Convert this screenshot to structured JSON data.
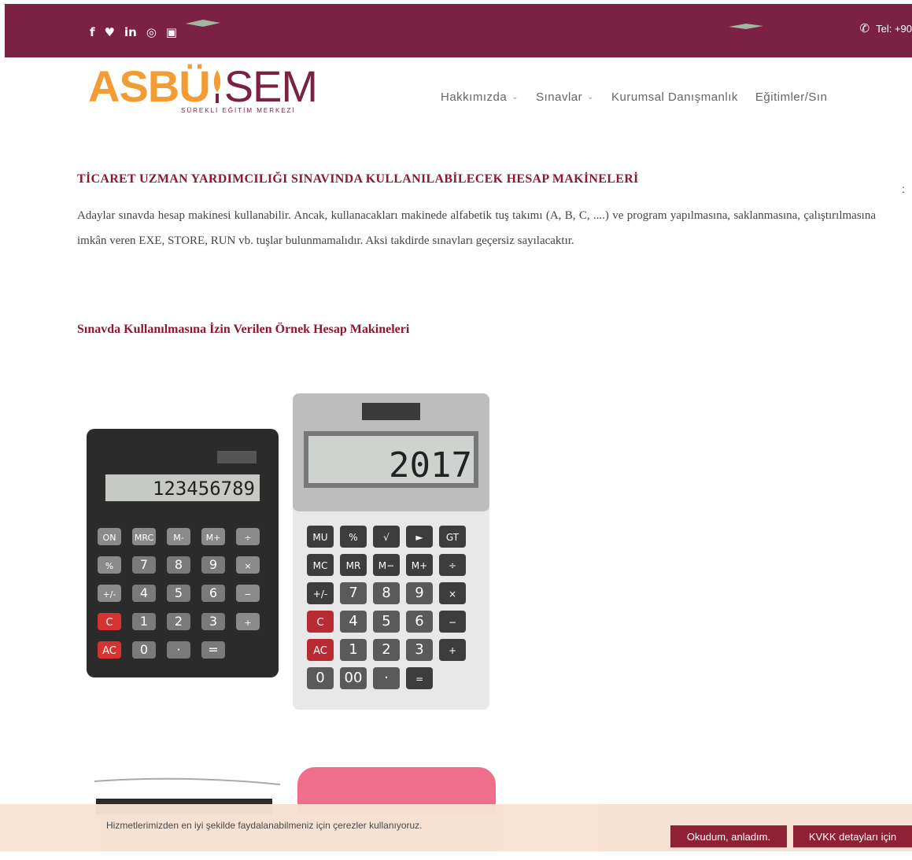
{
  "topbar": {
    "social": [
      {
        "icon": "facebook-icon",
        "glyph": "f"
      },
      {
        "icon": "twitter-icon",
        "glyph": "♥"
      },
      {
        "icon": "linkedin-icon",
        "glyph": "in"
      },
      {
        "icon": "instagram-icon",
        "glyph": "◎"
      },
      {
        "icon": "youtube-icon",
        "glyph": "▣"
      }
    ],
    "phone_text": "Tel: +90"
  },
  "logo": {
    "part1": "ASBÜ",
    "part2": "SEM",
    "sub": "SÜREKLİ EĞİTİM MERKEZİ"
  },
  "nav": {
    "items": [
      {
        "label": "Hakkımızda",
        "dropdown": true
      },
      {
        "label": "Sınavlar",
        "dropdown": true
      },
      {
        "label": "Kurumsal Danışmanlık",
        "dropdown": false
      },
      {
        "label": "Eğitimler/Sın",
        "dropdown": false
      }
    ]
  },
  "content": {
    "title": "TİCARET UZMAN YARDIMCILIĞI SINAVINDA KULLANILABİLECEK HESAP MAKİNELERİ",
    "colon": ":",
    "paragraph": "Adaylar sınavda hesap makinesi kullanabilir. Ancak, kullanacakları makinede alfabetik tuş takımı (A, B, C, ....) ve program yapılmasına, saklanmasına, çalıştırılmasına imkân veren EXE, STORE, RUN vb. tuşlar bulunmamalıdır. Aksi takdirde sınavları geçersiz sayılacaktır.",
    "subtitle": "Sınavda Kullanılmasına İzin Verilen Örnek Hesap Makineleri"
  },
  "calculators": {
    "left_display": "123456789",
    "right_display": "2017",
    "left_keys": [
      "ON",
      "MRC",
      "M-",
      "M+",
      "÷",
      "%",
      "7",
      "8",
      "9",
      "×",
      "+/-",
      "4",
      "5",
      "6",
      "−",
      "C",
      "1",
      "2",
      "3",
      "+",
      "AC",
      "0",
      "·",
      "="
    ],
    "right_keys": [
      "MU",
      "%",
      "√",
      "►",
      "GT",
      "MC",
      "MR",
      "M−",
      "M+",
      "÷",
      "+/-",
      "7",
      "8",
      "9",
      "×",
      "C",
      "4",
      "5",
      "6",
      "−",
      "AC",
      "1",
      "2",
      "3",
      "+",
      "0",
      "00",
      "·",
      "="
    ]
  },
  "cookie": {
    "text": "Hizmetlerimizden en iyi şekilde faydalanabilmeniz için çerezler kullanıyoruz.",
    "accept": "Okudum, anladım.",
    "kvkk": "KVKK detayları için"
  },
  "colors": {
    "brand": "#7b2143",
    "accent": "#f29c33",
    "heading": "#8b1a2e"
  }
}
